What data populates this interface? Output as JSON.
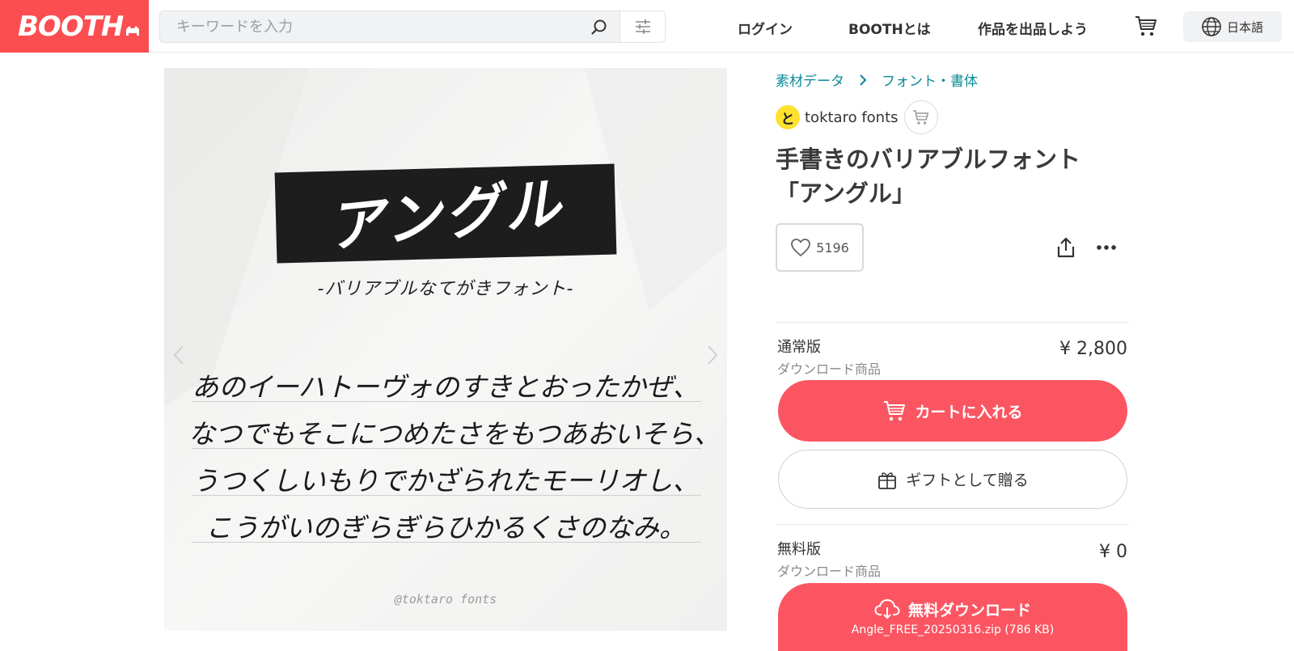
{
  "header": {
    "logo": "BOOTH",
    "search_placeholder": "キーワードを入力",
    "nav": {
      "login": "ログイン",
      "about": "BOOTHとは",
      "sell": "作品を出品しよう"
    },
    "language": "日本語"
  },
  "gallery": {
    "title": "アングル",
    "subtitle": "-バリアブルなてがきフォント-",
    "poem": [
      "あのイーハトーヴォのすきとおったかぜ、",
      "なつでもそこにつめたさをもつあおいそら、",
      "うつくしいもりでかざられたモーリオし、",
      "こうがいのぎらぎらひかるくさのなみ。"
    ],
    "watermark": "@toktaro fonts"
  },
  "breadcrumb": [
    "素材データ",
    "フォント・書体"
  ],
  "shop": {
    "avatar_letter": "と",
    "name": "toktaro fonts"
  },
  "item": {
    "title_line1": "手書きのバリアブルフォント",
    "title_line2": "「アングル」",
    "likes": "5196"
  },
  "variants": [
    {
      "name": "通常版",
      "type": "ダウンロード商品",
      "price": "¥ 2,800",
      "primary_label": "カートに入れる",
      "gift_label": "ギフトとして贈る"
    },
    {
      "name": "無料版",
      "type": "ダウンロード商品",
      "price": "¥ 0",
      "primary_label": "無料ダウンロード",
      "file": "Angle_FREE_20250316.zip (786 KB)"
    }
  ],
  "colors": {
    "brand": "#fc4d50",
    "button": "#fc5562",
    "link": "#0b8a99",
    "avatar": "#ffe12e"
  }
}
